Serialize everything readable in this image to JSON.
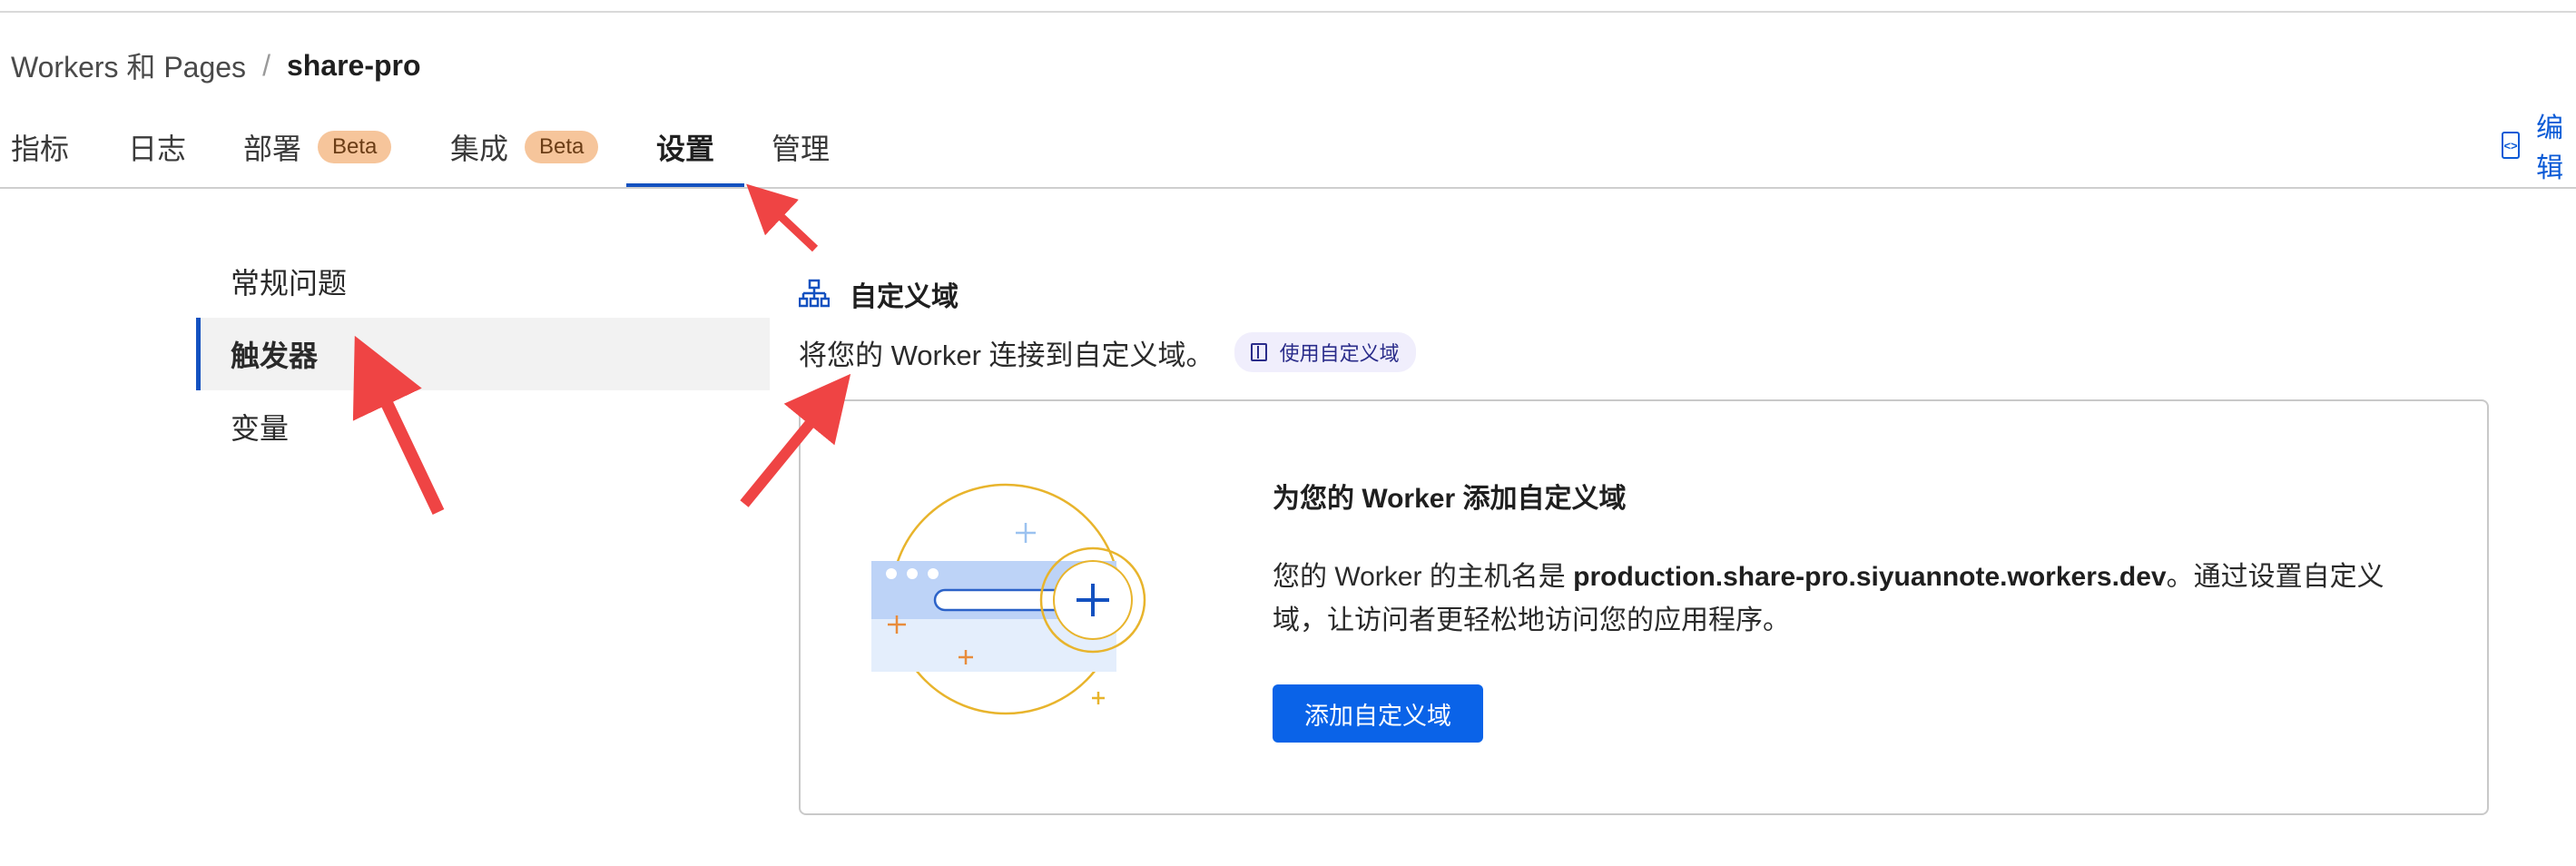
{
  "breadcrumb": {
    "parent": "Workers 和 Pages",
    "separator": "/",
    "current": "share-pro"
  },
  "tabs": [
    {
      "label": "指标"
    },
    {
      "label": "日志"
    },
    {
      "label": "部署",
      "badge": "Beta"
    },
    {
      "label": "集成",
      "badge": "Beta"
    },
    {
      "label": "设置",
      "active": true
    },
    {
      "label": "管理"
    }
  ],
  "header_actions": {
    "edit_label": "编辑"
  },
  "sidenav": {
    "items": [
      {
        "label": "常规问题"
      },
      {
        "label": "触发器",
        "active": true
      },
      {
        "label": "变量"
      }
    ]
  },
  "section": {
    "icon": "sitemap-icon",
    "title": "自定义域",
    "description": "将您的 Worker 连接到自定义域。",
    "doc_link": "使用自定义域"
  },
  "card": {
    "title": "为您的 Worker 添加自定义域",
    "body_prefix": "您的 Worker 的主机名是 ",
    "hostname": "production.share-pro.siyuannote.workers.dev",
    "body_suffix": "。通过设置自定义域，让访问者更轻松地访问您的应用程序。",
    "button_label": "添加自定义域"
  },
  "colors": {
    "accent": "#0a63e8",
    "tab_underline": "#1351c0",
    "beta_badge": "#f6c59b",
    "annotation_arrow": "#ef4444"
  }
}
